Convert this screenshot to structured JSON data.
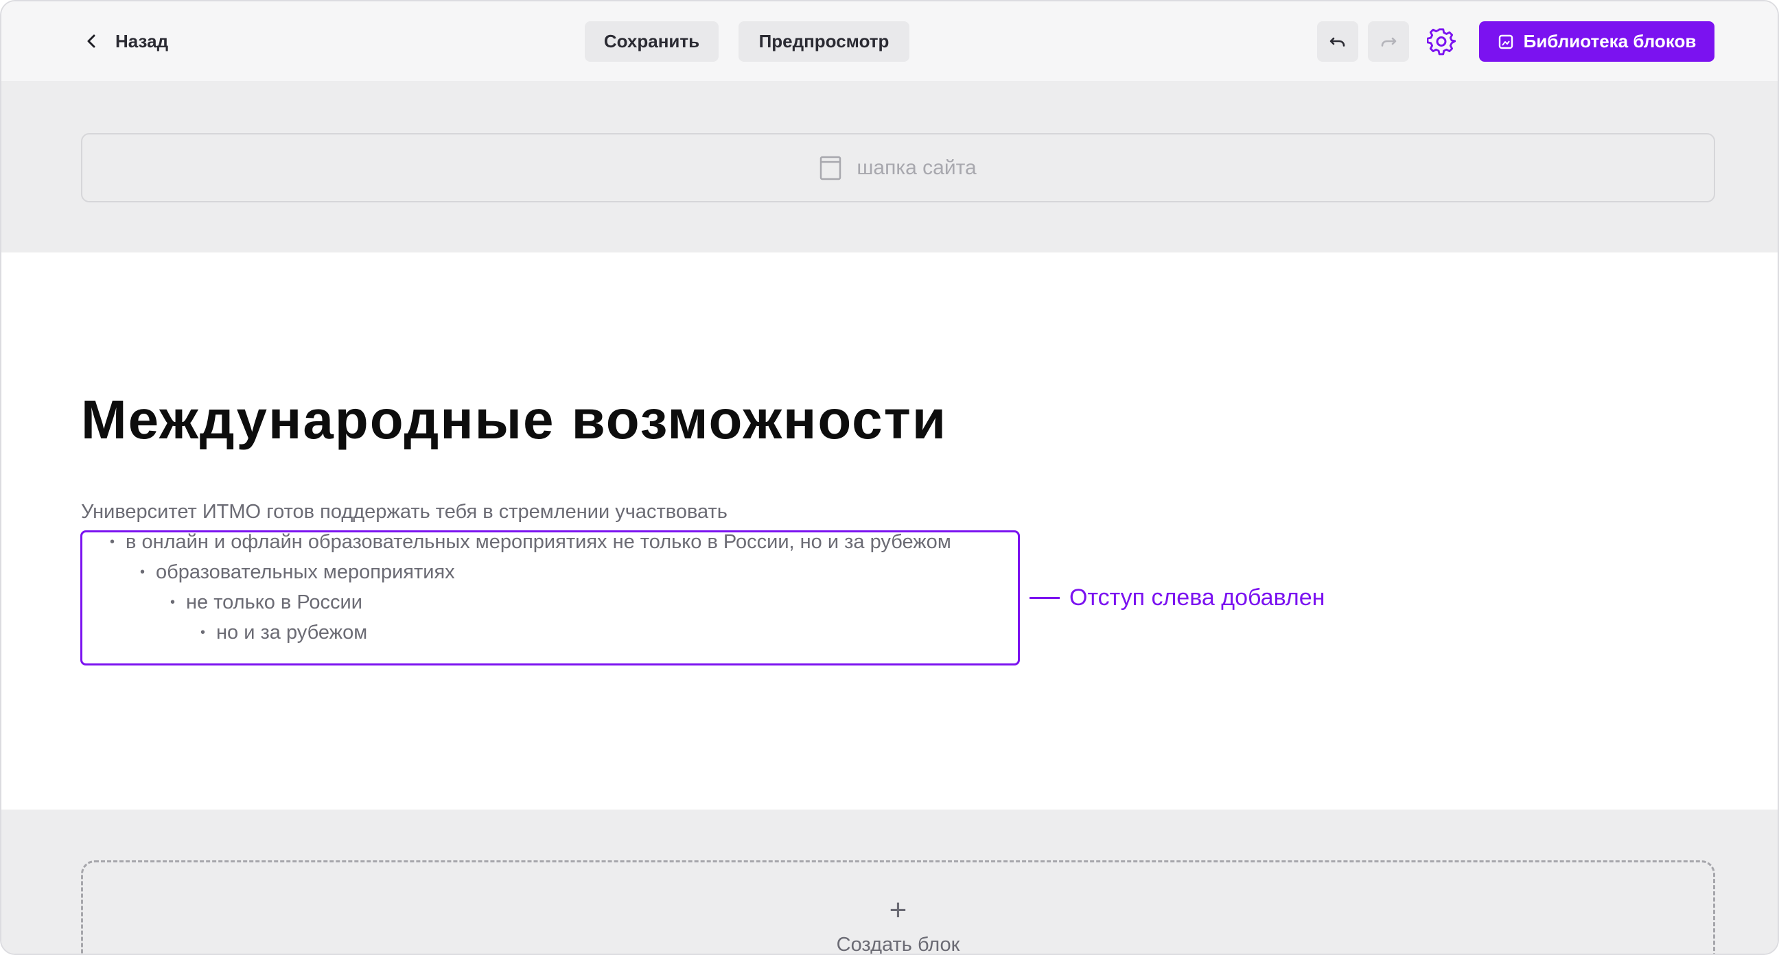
{
  "toolbar": {
    "back_label": "Назад",
    "save_label": "Сохранить",
    "preview_label": "Предпросмотр",
    "library_label": "Библиотека блоков",
    "accent_color": "#7b12f0"
  },
  "site_header": {
    "label": "шапка сайта"
  },
  "content": {
    "title": "Международные возможности",
    "intro": "Университет ИТМО готов поддержать тебя в стремлении участвовать",
    "bullets": [
      {
        "text": "в онлайн и офлайн образовательных мероприятиях не только в России, но и за рубежом",
        "level": 1
      },
      {
        "text": "образовательных мероприятиях",
        "level": 2
      },
      {
        "text": "не только в России",
        "level": 3
      },
      {
        "text": "но и за рубежом",
        "level": 4
      }
    ],
    "annotation": "Отступ слева добавлен"
  },
  "create_block": {
    "icon": "plus-icon",
    "label": "Создать блок"
  }
}
